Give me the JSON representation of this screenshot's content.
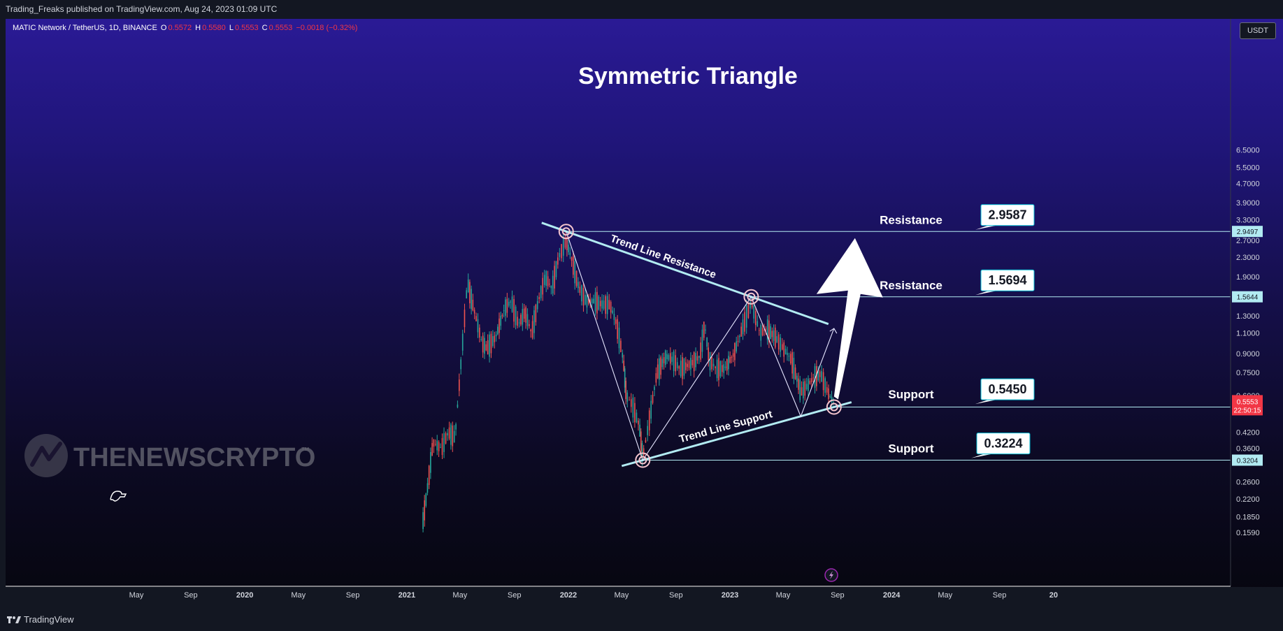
{
  "header": {
    "published": "Trading_Freaks published on TradingView.com, Aug 24, 2023 01:09 UTC"
  },
  "symbol": {
    "name": "MATIC Network / TetherUS, 1D, BINANCE",
    "open_label": "O",
    "open": "0.5572",
    "high_label": "H",
    "high": "0.5580",
    "low_label": "L",
    "low": "0.5553",
    "close_label": "C",
    "close": "0.5553",
    "change": "−0.0018 (−0.32%)"
  },
  "currency": "USDT",
  "brand": {
    "name": "TradingView",
    "watermark": "THENEWSCRYPTO",
    "watermark_tm": "™"
  },
  "colors": {
    "accent": "#00e5ff",
    "line": "#b2ebf2",
    "candle_up": "#26a69a",
    "candle_down": "#ef5350",
    "price_badge": "#f23645",
    "label_badge_bg": "#ffffff"
  },
  "chart_data": {
    "type": "line",
    "title": "Symmetric Triangle",
    "subtitle": "",
    "xlabel": "",
    "ylabel": "",
    "y_scale": "log",
    "ylim": [
      0.159,
      6.9
    ],
    "y_ticks": [
      "6.5000",
      "5.5000",
      "4.7000",
      "3.9000",
      "3.3000",
      "2.7000",
      "2.3000",
      "1.9000",
      "1.3000",
      "1.1000",
      "0.9000",
      "0.7500",
      "0.6000",
      "0.4200",
      "0.3600",
      "0.2600",
      "0.2200",
      "0.1850",
      "0.1590"
    ],
    "y_tick_values": [
      6.5,
      5.5,
      4.7,
      3.9,
      3.3,
      2.7,
      2.3,
      1.9,
      1.3,
      1.1,
      0.9,
      0.75,
      0.6,
      0.42,
      0.36,
      0.26,
      0.22,
      0.185,
      0.159
    ],
    "x_ticks": [
      "May",
      "Sep",
      "2020",
      "May",
      "Sep",
      "2021",
      "May",
      "Sep",
      "2022",
      "May",
      "Sep",
      "2023",
      "May",
      "Sep",
      "2024",
      "May",
      "Sep",
      "20"
    ],
    "x_tick_dates": [
      "2019-05-01",
      "2019-09-01",
      "2020-01-01",
      "2020-05-01",
      "2020-09-01",
      "2021-01-01",
      "2021-05-01",
      "2021-09-01",
      "2022-01-01",
      "2022-05-01",
      "2022-09-01",
      "2023-01-01",
      "2023-05-01",
      "2023-09-01",
      "2024-01-01",
      "2024-05-01",
      "2024-09-01",
      "2025-01-01"
    ],
    "series": [
      {
        "type": "candlestick-outline",
        "dates": [
          "2021-02-05",
          "2021-02-15",
          "2021-03-01",
          "2021-03-20",
          "2021-04-05",
          "2021-04-20",
          "2021-05-05",
          "2021-05-18",
          "2021-06-01",
          "2021-06-20",
          "2021-07-01",
          "2021-07-20",
          "2021-08-10",
          "2021-08-25",
          "2021-09-10",
          "2021-09-25",
          "2021-10-10",
          "2021-10-25",
          "2021-11-10",
          "2021-11-25",
          "2021-12-10",
          "2021-12-27",
          "2022-01-10",
          "2022-01-25",
          "2022-02-10",
          "2022-03-01",
          "2022-03-20",
          "2022-04-05",
          "2022-04-20",
          "2022-05-05",
          "2022-05-12",
          "2022-05-25",
          "2022-06-10",
          "2022-06-18",
          "2022-07-01",
          "2022-07-20",
          "2022-08-10",
          "2022-08-25",
          "2022-09-10",
          "2022-09-25",
          "2022-10-10",
          "2022-10-25",
          "2022-11-05",
          "2022-11-15",
          "2022-12-01",
          "2022-12-20",
          "2023-01-10",
          "2023-02-01",
          "2023-02-18",
          "2023-03-10",
          "2023-03-25",
          "2023-04-15",
          "2023-05-01",
          "2023-05-20",
          "2023-06-10",
          "2023-06-25",
          "2023-07-10",
          "2023-07-25",
          "2023-08-10",
          "2023-08-24"
        ],
        "values": [
          0.17,
          0.23,
          0.38,
          0.36,
          0.42,
          0.4,
          0.9,
          1.8,
          1.4,
          1.0,
          0.95,
          1.05,
          1.4,
          1.5,
          1.2,
          1.35,
          1.1,
          1.5,
          1.9,
          1.7,
          2.3,
          2.7,
          2.2,
          1.7,
          1.5,
          1.5,
          1.45,
          1.45,
          1.2,
          0.85,
          0.6,
          0.55,
          0.45,
          0.33,
          0.45,
          0.75,
          0.88,
          0.85,
          0.78,
          0.8,
          0.83,
          0.88,
          1.2,
          0.85,
          0.78,
          0.78,
          0.9,
          1.2,
          1.48,
          1.1,
          1.15,
          1.05,
          0.95,
          0.85,
          0.62,
          0.66,
          0.72,
          0.74,
          0.62,
          0.5553
        ]
      }
    ],
    "annotations": [
      {
        "text": "Trend Line Resistance",
        "type": "trendline"
      },
      {
        "text": "Trend Line Support",
        "type": "trendline"
      },
      {
        "text": "Resistance",
        "value": 2.9587,
        "label": "2.9587"
      },
      {
        "text": "Resistance",
        "value": 1.5694,
        "label": "1.5694"
      },
      {
        "text": "Support",
        "value": 0.545,
        "label": "0.5450"
      },
      {
        "text": "Support",
        "value": 0.3224,
        "label": "0.3224"
      }
    ],
    "price_marks": [
      {
        "value": 2.9497,
        "label": "2.9497"
      },
      {
        "value": 1.5644,
        "label": "1.5644"
      },
      {
        "value": 0.5365,
        "label": "0.5365"
      },
      {
        "value": 0.3204,
        "label": "0.3204"
      }
    ],
    "current_price": {
      "value": 0.5553,
      "label": "0.5553",
      "countdown": "22:50:15"
    },
    "pivots": [
      {
        "date": "2021-12-27",
        "value": 2.9497
      },
      {
        "date": "2022-06-18",
        "value": 0.3204
      },
      {
        "date": "2023-02-18",
        "value": 1.5644
      },
      {
        "date": "2023-06-10",
        "value": 0.49
      },
      {
        "date": "2023-08-24",
        "value": 0.5365
      }
    ],
    "wave_path": [
      {
        "date": "2021-12-27",
        "value": 2.9497
      },
      {
        "date": "2022-06-18",
        "value": 0.3204
      },
      {
        "date": "2023-02-18",
        "value": 1.5644
      },
      {
        "date": "2023-06-10",
        "value": 0.49
      },
      {
        "date": "2023-08-24",
        "value": 1.15
      }
    ],
    "grid": false,
    "legend": "none"
  }
}
